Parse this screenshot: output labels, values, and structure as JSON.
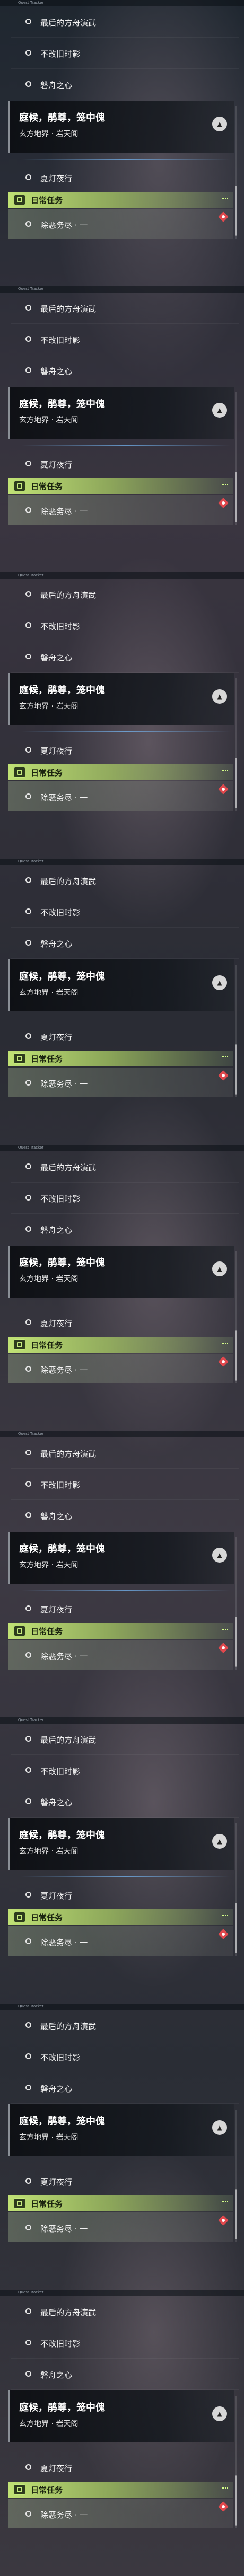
{
  "topbar": {
    "tiny_text": "Quest Tracker"
  },
  "sub_quests": [
    {
      "label": "最后的方舟演武"
    },
    {
      "label": "不改旧时影"
    },
    {
      "label": "磐舟之心"
    }
  ],
  "main_quest": {
    "title": "庭候，鹃尊，笼中傀",
    "subtitle": "玄方地界 · 岩天阁"
  },
  "tracked_quest": {
    "label": "夏灯夜行"
  },
  "daily": {
    "header": "日常任务",
    "item_label": "除恶务尽 · 一"
  },
  "colors": {
    "daily_accent": "#c7ec7f",
    "badge_red": "#e0484d"
  }
}
